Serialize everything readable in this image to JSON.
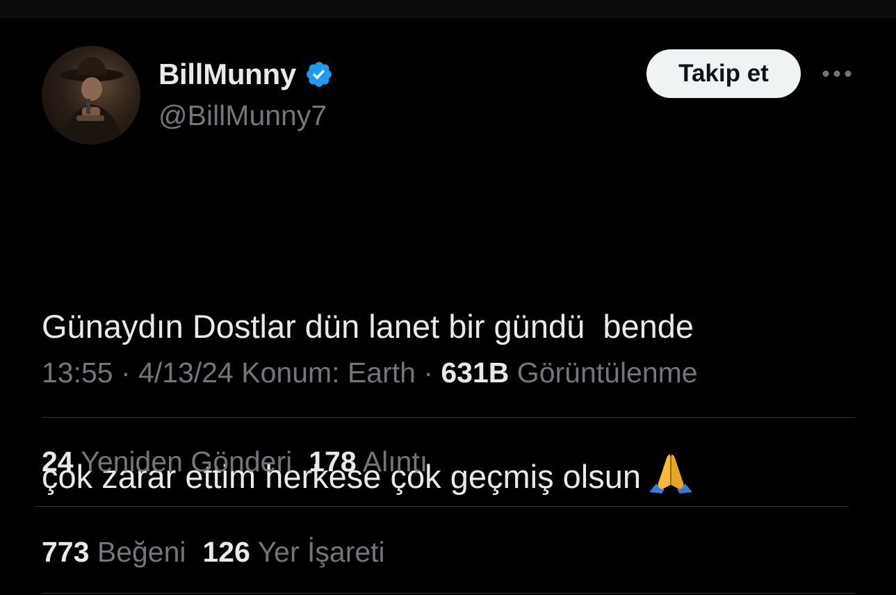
{
  "tweet": {
    "author": {
      "display_name": "BillMunny",
      "handle": "@BillMunny7",
      "verified": true,
      "avatar_icon": "avatar-cowboy"
    },
    "follow_label": "Takip et",
    "more_icon": "more-horizontal-icon",
    "text_lines": [
      "Günaydın Dostlar dün lanet bir gündü  bende",
      "çok zarar ettim herkese çok geçmiş olsun"
    ],
    "emoji": "folded-hands",
    "meta": {
      "time": "13:55",
      "separator": " · ",
      "date": "4/13/24",
      "location": "Konum: Earth",
      "views_count": "631B",
      "views_label": "Görüntülenme"
    },
    "stats": {
      "retweets_count": "24",
      "retweets_label": "Yeniden Gönderi",
      "quotes_count": "178",
      "quotes_label": "Alıntı",
      "likes_count": "773",
      "likes_label": "Beğeni",
      "bookmarks_count": "126",
      "bookmarks_label": "Yer İşareti"
    }
  },
  "colors": {
    "background": "#000000",
    "primary_text": "#e7e9ea",
    "secondary_text": "#71767b",
    "divider": "#2f3336",
    "verified_badge": "#1d9bf0",
    "follow_button_bg": "#eff3f4"
  }
}
